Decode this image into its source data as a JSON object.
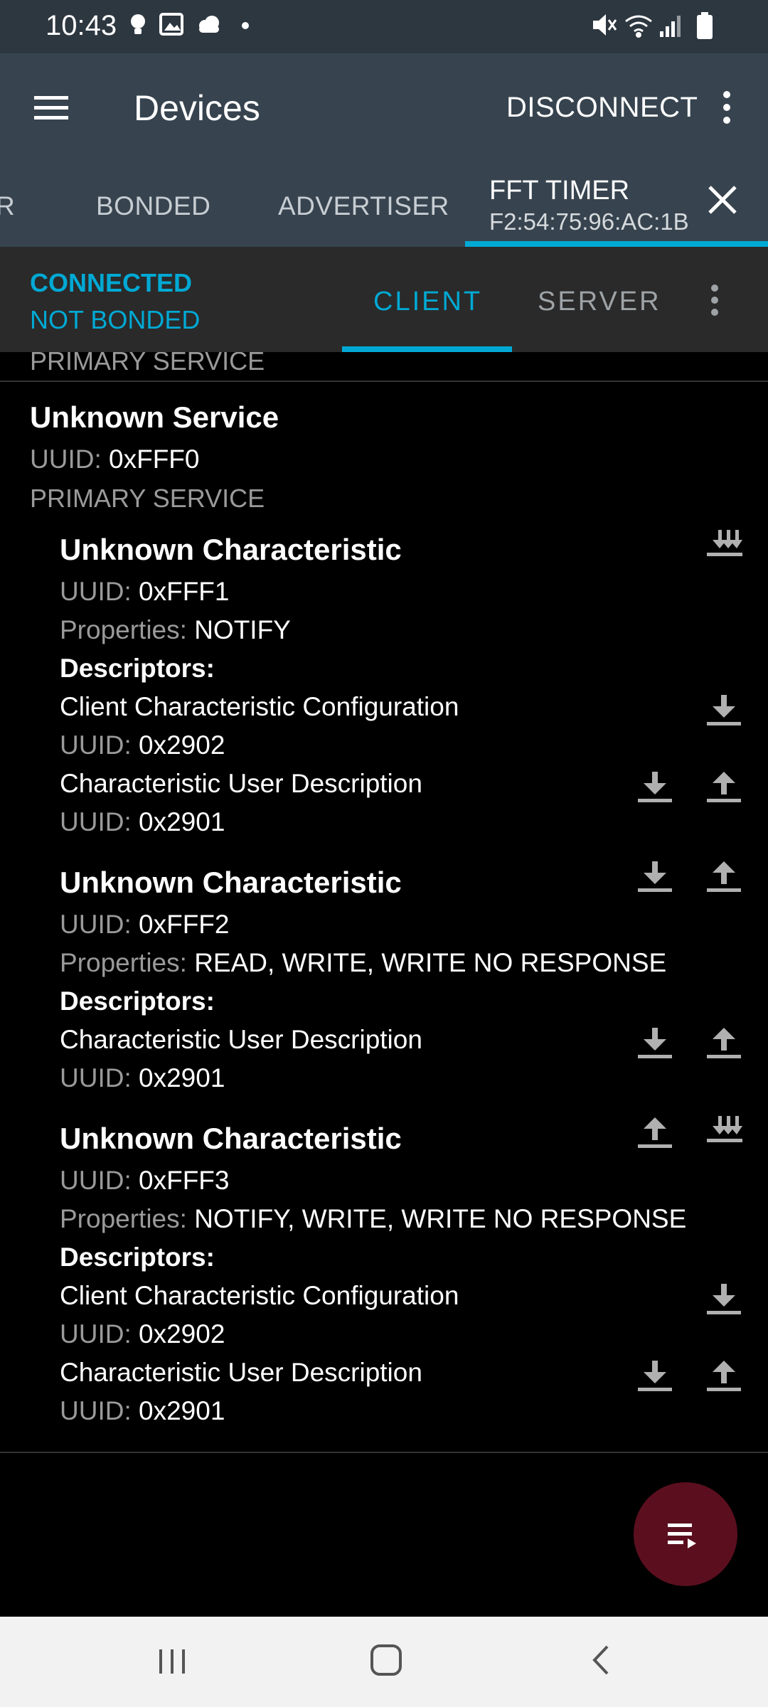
{
  "status_bar": {
    "time": "10:43",
    "left_icons": [
      "lightbulb-icon",
      "image-icon",
      "cloud-icon",
      "dot-icon"
    ],
    "right_icons": [
      "mute-icon",
      "wifi-icon",
      "signal-icon",
      "battery-icon"
    ]
  },
  "app_bar": {
    "title": "Devices",
    "disconnect_label": "DISCONNECT"
  },
  "device_tabs": {
    "items": [
      {
        "label": "R"
      },
      {
        "label": "BONDED"
      },
      {
        "label": "ADVERTISER"
      }
    ],
    "active": {
      "name": "FFT TIMER",
      "address": "F2:54:75:96:AC:1B"
    },
    "accent_color": "#00a9d4"
  },
  "connection": {
    "status": "CONNECTED",
    "bond_state": "NOT BONDED",
    "tabs": [
      {
        "label": "CLIENT",
        "active": true
      },
      {
        "label": "SERVER",
        "active": false
      }
    ]
  },
  "labels": {
    "uuid": "UUID:",
    "properties": "Properties:",
    "descriptors": "Descriptors:"
  },
  "services": {
    "prev_type": "PRIMARY SERVICE",
    "service": {
      "name": "Unknown Service",
      "uuid": "0xFFF0",
      "type": "PRIMARY SERVICE"
    },
    "characteristics": [
      {
        "name": "Unknown Characteristic",
        "uuid": "0xFFF1",
        "properties": "NOTIFY",
        "actions": [
          "notify-icon"
        ],
        "descriptors": [
          {
            "name": "Client Characteristic Configuration",
            "uuid": "0x2902",
            "actions": [
              "read-icon"
            ]
          },
          {
            "name": "Characteristic User Description",
            "uuid": "0x2901",
            "actions": [
              "read-icon",
              "write-icon"
            ]
          }
        ]
      },
      {
        "name": "Unknown Characteristic",
        "uuid": "0xFFF2",
        "properties": "READ, WRITE, WRITE NO RESPONSE",
        "actions": [
          "read-icon",
          "write-icon"
        ],
        "descriptors": [
          {
            "name": "Characteristic User Description",
            "uuid": "0x2901",
            "actions": [
              "read-icon",
              "write-icon"
            ]
          }
        ]
      },
      {
        "name": "Unknown Characteristic",
        "uuid": "0xFFF3",
        "properties": "NOTIFY, WRITE, WRITE NO RESPONSE",
        "actions": [
          "write-icon",
          "notify-icon"
        ],
        "descriptors": [
          {
            "name": "Client Characteristic Configuration",
            "uuid": "0x2902",
            "actions": [
              "read-icon"
            ]
          },
          {
            "name": "Characteristic User Description",
            "uuid": "0x2901",
            "actions": [
              "read-icon",
              "write-icon"
            ]
          }
        ]
      }
    ]
  },
  "fab": {
    "icon": "log-list-icon",
    "color": "#5b0f1e"
  },
  "nav_bar": {
    "icons": [
      "recents-icon",
      "home-icon",
      "back-icon"
    ]
  }
}
